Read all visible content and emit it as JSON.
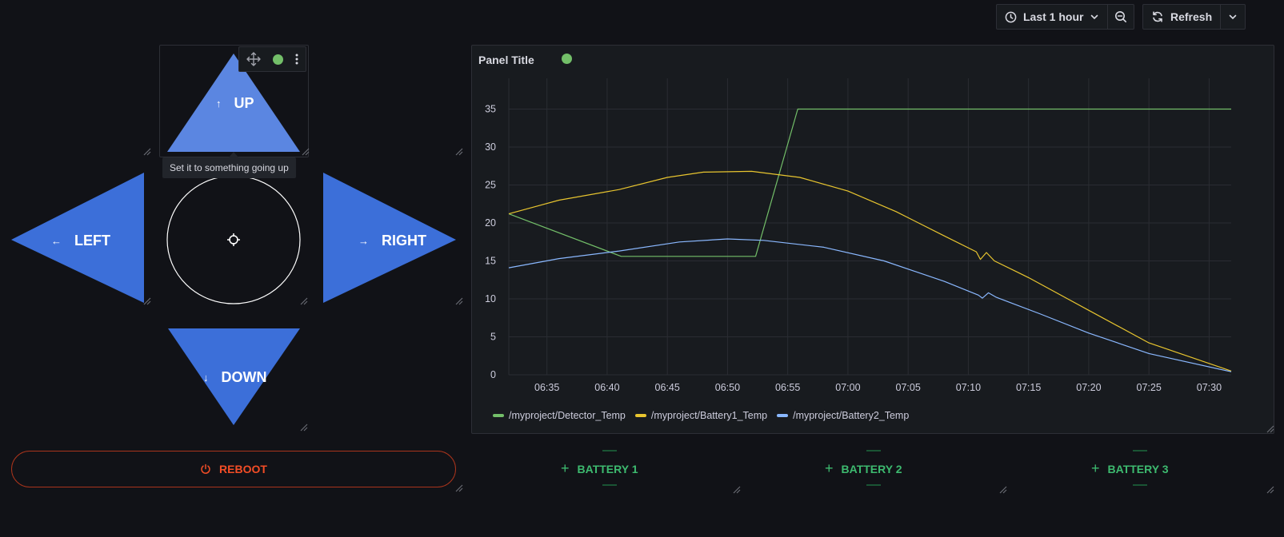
{
  "toolbar": {
    "time_range": "Last 1 hour",
    "refresh": "Refresh"
  },
  "controls": {
    "up": "UP",
    "down": "DOWN",
    "left": "LEFT",
    "right": "RIGHT",
    "up_tooltip": "Set it to something going up",
    "reboot": "REBOOT",
    "colors": {
      "arrow": "#3c6fd9",
      "arrow_up": "#5b86e1",
      "reboot": "#f44d26"
    }
  },
  "chart_panel": {
    "title": "Panel Title",
    "status_color": "#73bf69"
  },
  "chart_data": {
    "type": "line",
    "x_ticks": [
      "06:35",
      "06:40",
      "06:45",
      "06:50",
      "06:55",
      "07:00",
      "07:05",
      "07:10",
      "07:15",
      "07:20",
      "07:25",
      "07:30"
    ],
    "y_ticks": [
      "0",
      "5",
      "10",
      "15",
      "20",
      "25",
      "30",
      "35"
    ],
    "ylim": [
      0,
      38
    ],
    "xlim": [
      "06:31:50",
      "07:31:50"
    ],
    "grid": true,
    "legend_position": "bottom-left",
    "series": [
      {
        "name": "/myproject/Detector_Temp",
        "color": "#73bf69",
        "points": [
          [
            "06:31:50",
            21.2
          ],
          [
            "06:41:10",
            15.6
          ],
          [
            "06:52:20",
            15.6
          ],
          [
            "06:55:50",
            35.0
          ],
          [
            "07:31:50",
            35.0
          ]
        ]
      },
      {
        "name": "/myproject/Battery1_Temp",
        "color": "#e8c52f",
        "points": [
          [
            "06:31:50",
            21.2
          ],
          [
            "06:36:00",
            23.0
          ],
          [
            "06:41:00",
            24.4
          ],
          [
            "06:45:00",
            26.0
          ],
          [
            "06:48:00",
            26.7
          ],
          [
            "06:52:00",
            26.8
          ],
          [
            "06:56:00",
            26.0
          ],
          [
            "07:00:00",
            24.2
          ],
          [
            "07:04:00",
            21.5
          ],
          [
            "07:08:00",
            18.3
          ],
          [
            "07:10:40",
            16.2
          ],
          [
            "07:11:00",
            15.2
          ],
          [
            "07:11:30",
            16.1
          ],
          [
            "07:12:10",
            15.0
          ],
          [
            "07:15:00",
            12.8
          ],
          [
            "07:20:00",
            8.5
          ],
          [
            "07:25:00",
            4.2
          ],
          [
            "07:31:50",
            0.5
          ]
        ]
      },
      {
        "name": "/myproject/Battery2_Temp",
        "color": "#8ab8ff",
        "points": [
          [
            "06:31:50",
            14.1
          ],
          [
            "06:36:00",
            15.3
          ],
          [
            "06:41:00",
            16.3
          ],
          [
            "06:46:00",
            17.5
          ],
          [
            "06:50:00",
            17.9
          ],
          [
            "06:53:00",
            17.7
          ],
          [
            "06:58:00",
            16.8
          ],
          [
            "07:03:00",
            15.0
          ],
          [
            "07:08:00",
            12.3
          ],
          [
            "07:10:50",
            10.5
          ],
          [
            "07:11:10",
            10.1
          ],
          [
            "07:11:40",
            10.8
          ],
          [
            "07:12:20",
            10.2
          ],
          [
            "07:16:00",
            8.0
          ],
          [
            "07:20:00",
            5.5
          ],
          [
            "07:25:00",
            2.8
          ],
          [
            "07:31:50",
            0.4
          ]
        ]
      }
    ]
  },
  "batteries": [
    "BATTERY 1",
    "BATTERY 2",
    "BATTERY 3"
  ]
}
